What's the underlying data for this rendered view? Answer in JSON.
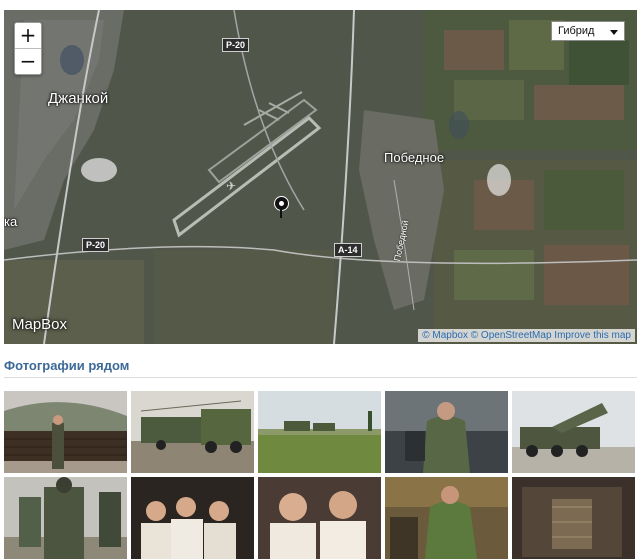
{
  "map": {
    "zoom_in_label": "+",
    "zoom_out_label": "−",
    "layer_select_value": "Гибрид",
    "places": {
      "dzhankoy": "Джанкой",
      "pobednoe": "Победное",
      "ka": "ка"
    },
    "roads": {
      "r20_north": "P-20",
      "r20_west": "P-20",
      "a14": "A-14"
    },
    "street_label": "Победной",
    "brand": "MapBox",
    "attribution": {
      "mapbox": "© Mapbox",
      "osm": "© OpenStreetMap",
      "improve": "Improve this map"
    },
    "marker_icon": "map-pin-icon"
  },
  "photos": {
    "title": "Фотографии рядом",
    "items": [
      {
        "subject": "soldier-by-stacked-crates"
      },
      {
        "subject": "military-trucks-column"
      },
      {
        "subject": "artillery-in-field"
      },
      {
        "subject": "soldier-by-armored-vehicle"
      },
      {
        "subject": "rocket-launcher-truck"
      },
      {
        "subject": "soldiers-in-camouflage"
      },
      {
        "subject": "group-of-young-men"
      },
      {
        "subject": "two-young-men-selfie"
      },
      {
        "subject": "soldier-in-green-uniform"
      },
      {
        "subject": "dark-interior-photo"
      }
    ]
  },
  "colors": {
    "title": "#3d6a96",
    "link": "#2a6bb0",
    "map_base": "#4f544a"
  }
}
